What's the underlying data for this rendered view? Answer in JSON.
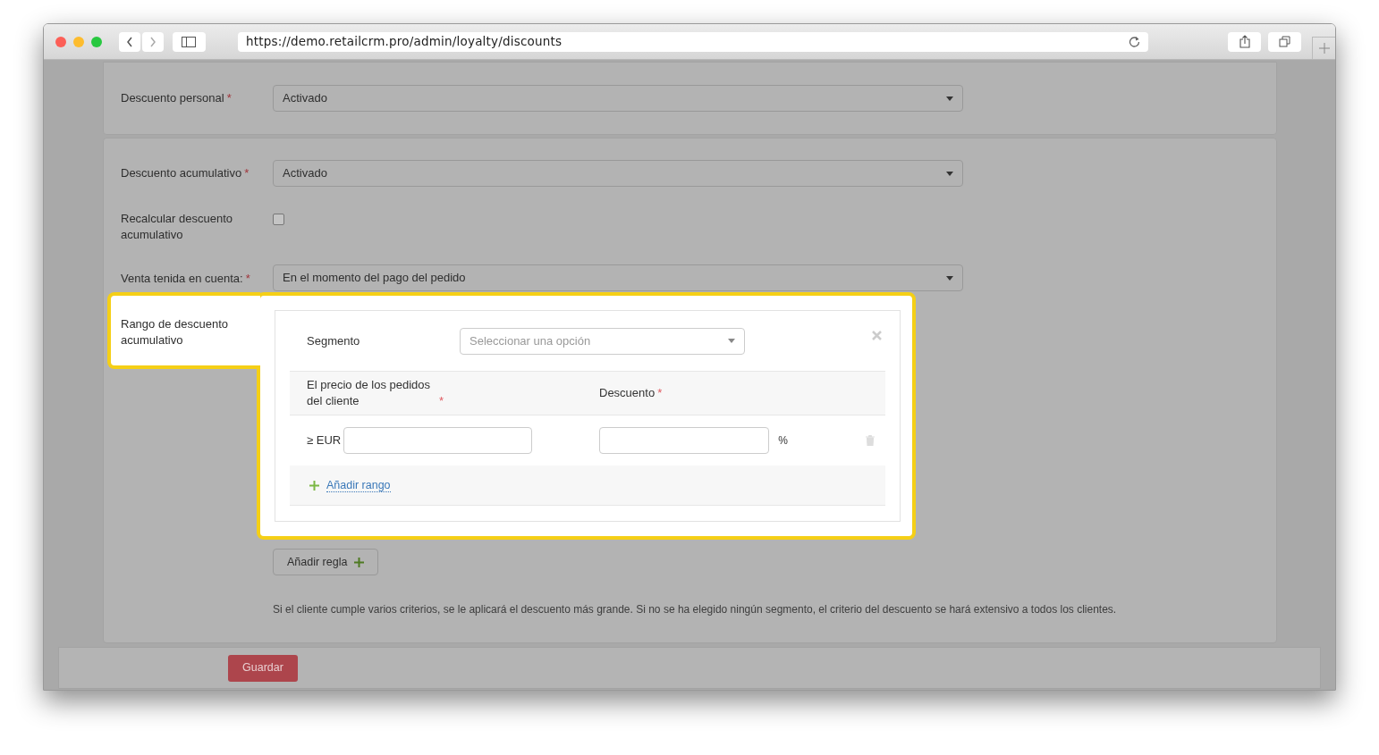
{
  "browser": {
    "url": "https://demo.retailcrm.pro/admin/loyalty/discounts"
  },
  "personal_discount": {
    "label": "Descuento personal",
    "required_mark": "*",
    "value": "Activado"
  },
  "accumulative": {
    "discount": {
      "label": "Descuento acumulativo",
      "required_mark": "*",
      "value": "Activado"
    },
    "recalculate": {
      "label": "Recalcular descuento acumulativo",
      "checked": false
    },
    "sale_counted": {
      "label": "Venta tenida en cuenta:",
      "required_mark": "*",
      "value": "En el momento del pago del pedido"
    },
    "range": {
      "label": "Rango de descuento acumulativo",
      "segment": {
        "label": "Segmento",
        "placeholder": "Seleccionar una opción"
      },
      "columns": [
        {
          "label": "El precio de los pedidos del cliente",
          "required_mark": "*"
        },
        {
          "label": "Descuento",
          "required_mark": "*"
        }
      ],
      "rows": [
        {
          "prefix": "≥ EUR",
          "unit": "%"
        }
      ],
      "add_range": "Añadir rango"
    },
    "add_rule": "Añadir regla",
    "note": "Si el cliente cumple varios criterios, se le aplicará el descuento más grande. Si no se ha elegido ningún segmento, el criterio del descuento se hará extensivo a todos los clientes."
  },
  "save_button": "Guardar"
}
